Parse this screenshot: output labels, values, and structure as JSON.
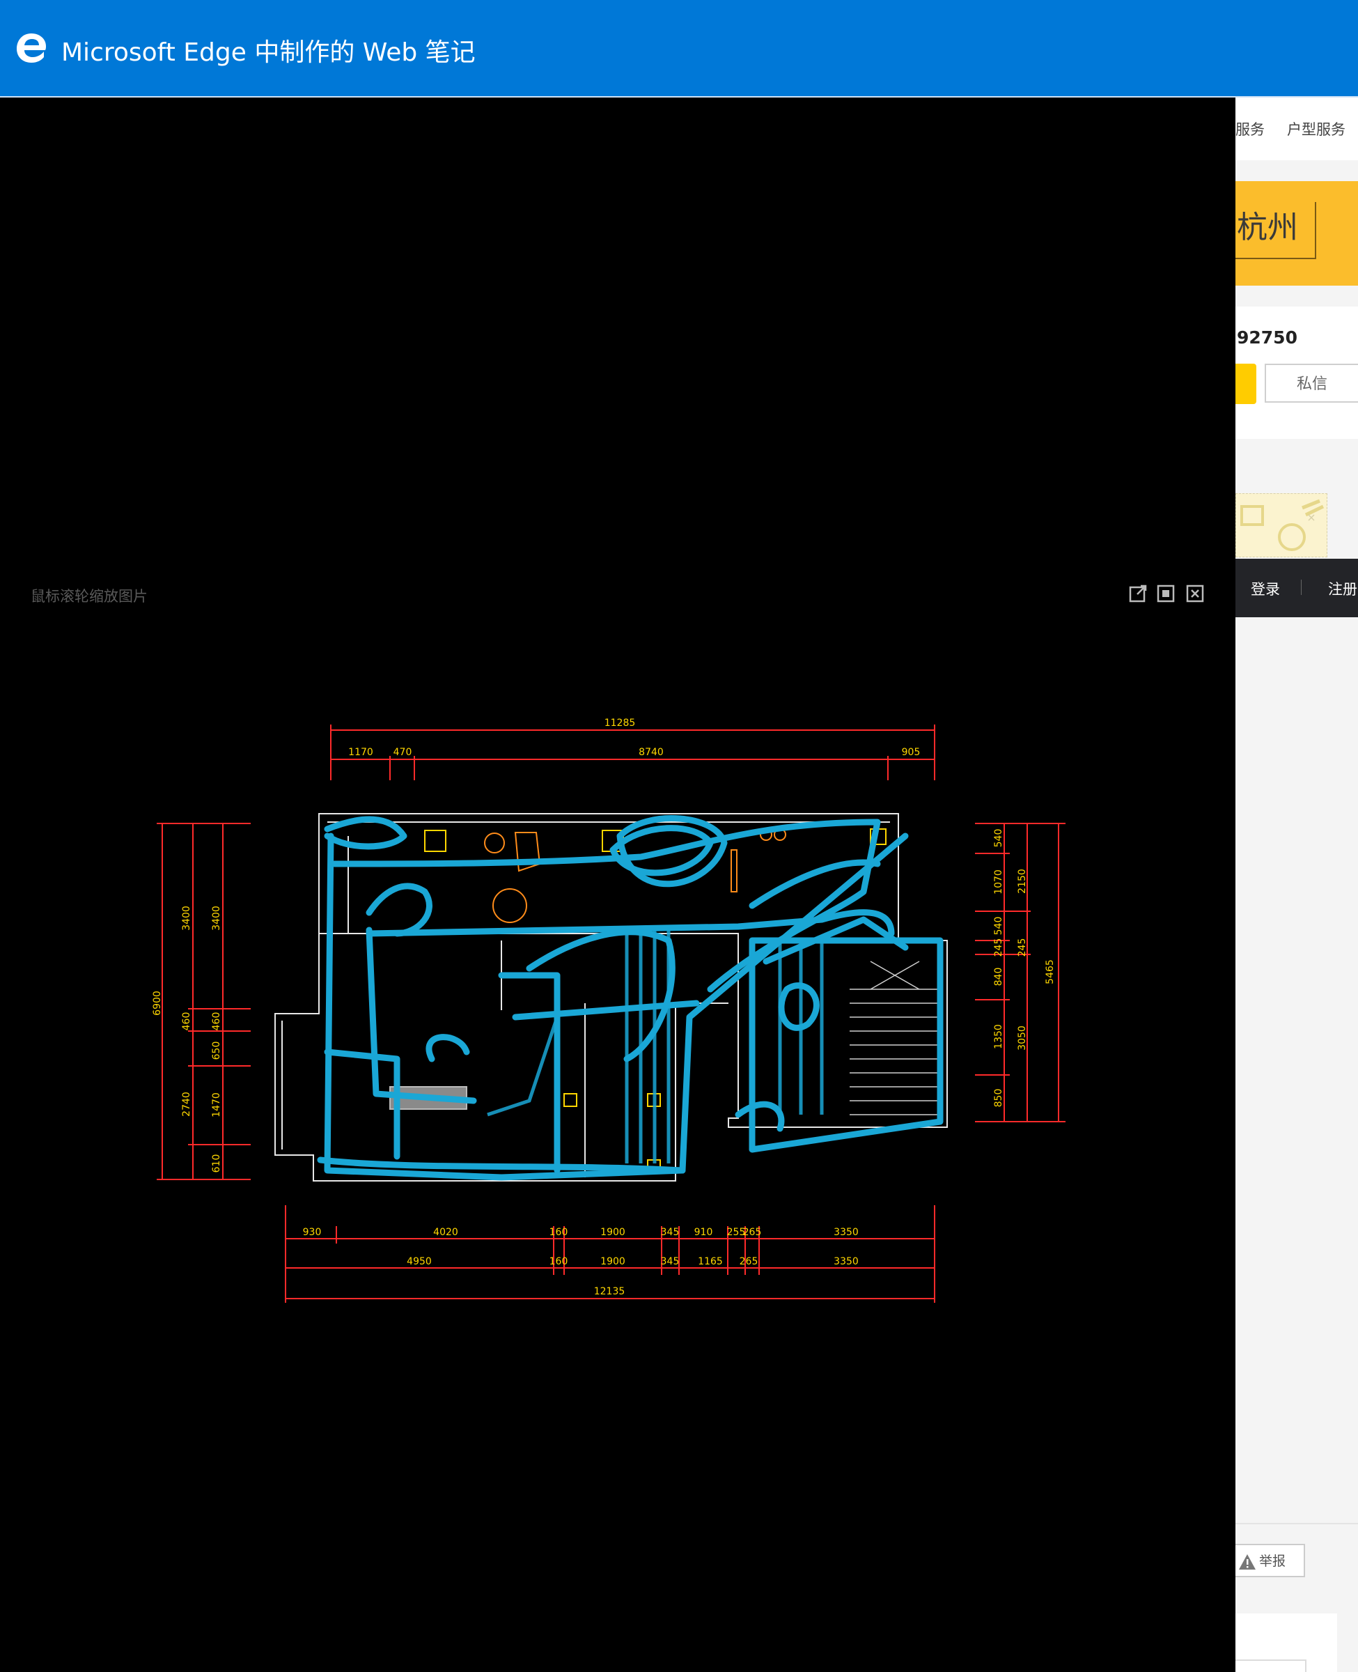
{
  "titlebar": {
    "title": "Microsoft Edge 中制作的 Web 笔记",
    "logo_icon": "edge-e-icon",
    "background_color": "#0078d7"
  },
  "viewer": {
    "hint": "鼠标滚轮缩放图片",
    "icons": [
      "open-original-icon",
      "fit-screen-icon",
      "close-icon"
    ]
  },
  "floorplan": {
    "top_total": "11285",
    "top_segments": [
      "1170",
      "470",
      "8740",
      "905"
    ],
    "bottom_row1": [
      "930",
      "4020",
      "160",
      "1900",
      "345",
      "910",
      "255",
      "265",
      "3350"
    ],
    "bottom_row2": [
      "4950",
      "160",
      "1900",
      "345",
      "1165",
      "265",
      "3350"
    ],
    "bottom_total": "12135",
    "left_outer": [
      "3400",
      "6900",
      "2740",
      "610"
    ],
    "left_inner": [
      "3400",
      "460",
      "460",
      "650",
      "1470"
    ],
    "right_inner": [
      "540",
      "1070",
      "540",
      "245",
      "840",
      "1350",
      "850"
    ],
    "right_mid": [
      "2150",
      "245",
      "3050"
    ],
    "right_outer": "5465",
    "annotation_color": "#1aa7d6",
    "dimension_color": "#ff2a2a"
  },
  "right_panel": {
    "nav": [
      "服务",
      "户型服务"
    ],
    "city": "杭州",
    "phone": "92750",
    "message_button": "私信",
    "login": "登录",
    "register": "注册",
    "report": "举报"
  }
}
